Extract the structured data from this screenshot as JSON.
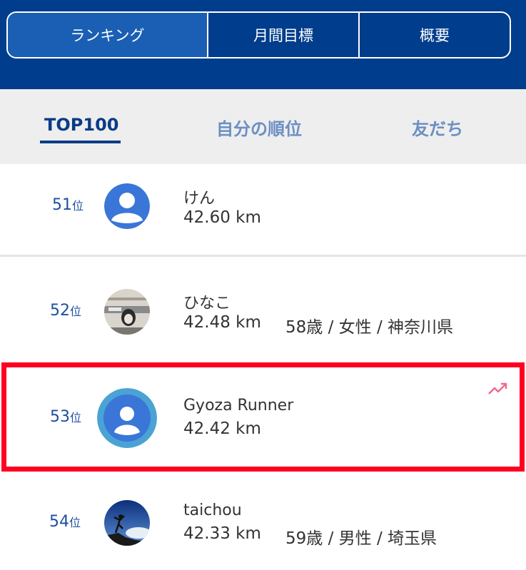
{
  "tabs": [
    "ランキング",
    "月間目標",
    "概要"
  ],
  "subtabs": [
    "TOP100",
    "自分の順位",
    "友だち"
  ],
  "rank_unit": "位",
  "rows": [
    {
      "rank": "51",
      "name": "けん",
      "distance": "42.60 km",
      "info": ""
    },
    {
      "rank": "52",
      "name": "ひなこ",
      "distance": "42.48 km",
      "info": "58歳 / 女性 / 神奈川県"
    },
    {
      "rank": "53",
      "name": "Gyoza Runner",
      "distance": "42.42 km",
      "info": ""
    },
    {
      "rank": "54",
      "name": "taichou",
      "distance": "42.33 km",
      "info": "59歳 / 男性 / 埼玉県"
    }
  ],
  "colors": {
    "header_bg": "#003d8c",
    "active_segment": "#1a5fb4",
    "rank_text": "#1e4fa0",
    "highlight_border": "#ff0022",
    "trend": "#f06a8c"
  },
  "icons": [
    "default-avatar-icon",
    "photo-avatar",
    "trend-up-icon"
  ]
}
